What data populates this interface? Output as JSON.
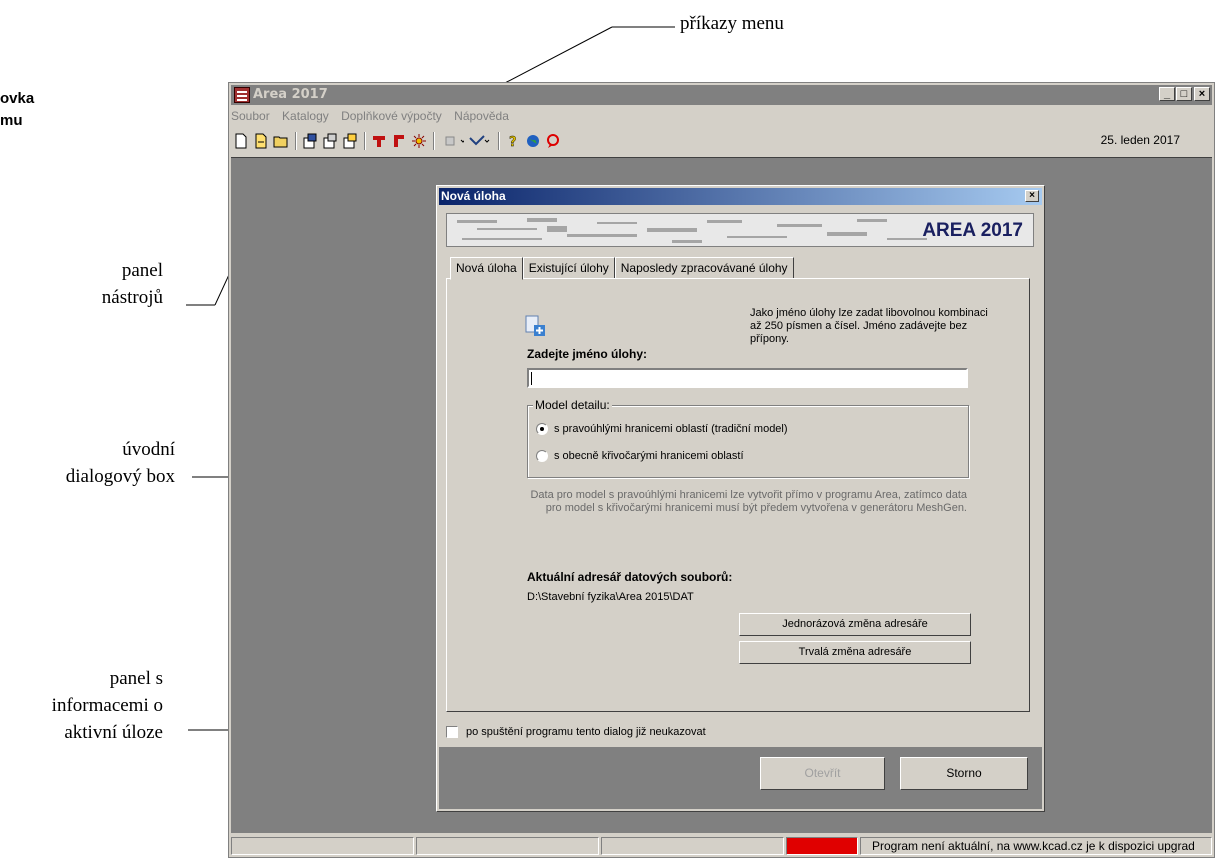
{
  "callouts": {
    "menu_commands": "příkazy menu",
    "title_bar_partial": "ovka\nmu",
    "toolbar_panel": "panel\nnástrojů",
    "intro_dialog": "úvodní\ndialogový box",
    "info_panel": "panel s\ninformacemi o\naktivní úloze"
  },
  "app": {
    "title": "Area 2017",
    "menu": [
      "Soubor",
      "Katalogy",
      "Doplňkové výpočty",
      "Nápověda"
    ],
    "date": "25. leden 2017",
    "window_buttons": [
      "_",
      "□",
      "×"
    ]
  },
  "dialog": {
    "title": "Nová úloha",
    "banner": "AREA 2017",
    "tabs": [
      "Nová úloha",
      "Existující úlohy",
      "Naposledy zpracovávané úlohy"
    ],
    "info_text": "Jako jméno úlohy lze zadat libovolnou kombinaci až 250 písmen a čísel. Jméno zadávejte bez přípony.",
    "name_label": "Zadejte jméno úlohy:",
    "name_value": "",
    "group_label": "Model detailu:",
    "options": [
      "s pravoúhlými hranicemi oblastí (tradiční model)",
      "s obecně křivočarými hranicemi oblastí"
    ],
    "selected_option": 0,
    "description": "Data pro model s pravoúhlými hranicemi lze vytvořit přímo v programu Area, zatímco data pro model s křivočarými hranicemi musí být předem vytvořena v generátoru MeshGen.",
    "dir_label": "Aktuální adresář datových souborů:",
    "dir_path": "D:\\Stavební fyzika\\Area 2015\\DAT",
    "btn_once": "Jednorázová změna adresáře",
    "btn_permanent": "Trvalá změna adresáře",
    "checkbox_label": "po spuštění programu tento dialog již neukazovat",
    "checkbox_checked": false,
    "btn_open": "Otevřít",
    "btn_cancel": "Storno"
  },
  "statusbar": {
    "message": "Program není aktuální, na www.kcad.cz je k dispozici upgrad",
    "alert_color": "#e00000"
  }
}
